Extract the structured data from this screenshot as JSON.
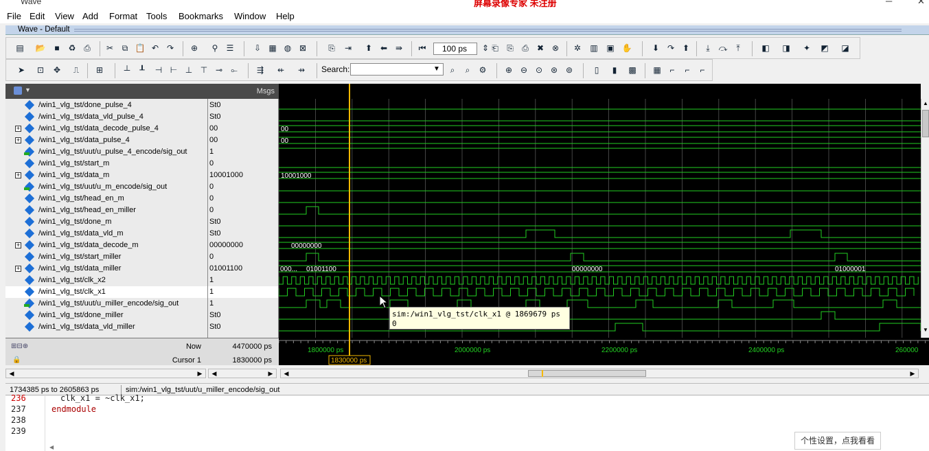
{
  "window": {
    "app_title": "Wave",
    "watermark": "屏幕录像专家 未注册",
    "controls": [
      "─",
      "□",
      "✕"
    ]
  },
  "menu": [
    "File",
    "Edit",
    "View",
    "Add",
    "Format",
    "Tools",
    "Bookmarks",
    "Window",
    "Help"
  ],
  "wave_window": {
    "title": "Wave - Default"
  },
  "toolbar": {
    "zoom_value": "100 ps",
    "search_label": "Search:",
    "search_value": ""
  },
  "panes": {
    "msgs_header": "Msgs",
    "now_label": "Now",
    "now_value": "4470000 ps",
    "cursor_label": "Cursor 1",
    "cursor_value": "1830000 ps",
    "cursor_time_tag": "1830000 ps"
  },
  "signals": [
    {
      "name": "/win1_vlg_tst/done_pulse_4",
      "value": "St0",
      "expandable": false,
      "kind": "net",
      "wave_text": ""
    },
    {
      "name": "/win1_vlg_tst/data_vld_pulse_4",
      "value": "St0",
      "expandable": false,
      "kind": "net",
      "wave_text": ""
    },
    {
      "name": "/win1_vlg_tst/data_decode_pulse_4",
      "value": "00",
      "expandable": true,
      "kind": "net",
      "wave_text": "00"
    },
    {
      "name": "/win1_vlg_tst/data_pulse_4",
      "value": "00",
      "expandable": true,
      "kind": "net",
      "wave_text": "00"
    },
    {
      "name": "/win1_vlg_tst/uut/u_pulse_4_encode/sig_out",
      "value": "1",
      "expandable": false,
      "kind": "out",
      "wave_text": ""
    },
    {
      "name": "/win1_vlg_tst/start_m",
      "value": "0",
      "expandable": false,
      "kind": "net",
      "wave_text": ""
    },
    {
      "name": "/win1_vlg_tst/data_m",
      "value": "10001000",
      "expandable": true,
      "kind": "net",
      "wave_text": "10001000"
    },
    {
      "name": "/win1_vlg_tst/uut/u_m_encode/sig_out",
      "value": "0",
      "expandable": false,
      "kind": "out",
      "wave_text": ""
    },
    {
      "name": "/win1_vlg_tst/head_en_m",
      "value": "0",
      "expandable": false,
      "kind": "net",
      "wave_text": ""
    },
    {
      "name": "/win1_vlg_tst/head_en_miller",
      "value": "0",
      "expandable": false,
      "kind": "net",
      "wave_text": ""
    },
    {
      "name": "/win1_vlg_tst/done_m",
      "value": "St0",
      "expandable": false,
      "kind": "net",
      "wave_text": ""
    },
    {
      "name": "/win1_vlg_tst/data_vld_m",
      "value": "St0",
      "expandable": false,
      "kind": "net",
      "wave_text": ""
    },
    {
      "name": "/win1_vlg_tst/data_decode_m",
      "value": "00000000",
      "expandable": true,
      "kind": "net",
      "wave_text": "00000000"
    },
    {
      "name": "/win1_vlg_tst/start_miller",
      "value": "0",
      "expandable": false,
      "kind": "net",
      "wave_text": ""
    },
    {
      "name": "/win1_vlg_tst/data_miller",
      "value": "01001100",
      "expandable": true,
      "kind": "net",
      "wave_text": "01001100"
    },
    {
      "name": "/win1_vlg_tst/clk_x2",
      "value": "1",
      "expandable": false,
      "kind": "net",
      "wave_text": ""
    },
    {
      "name": "/win1_vlg_tst/clk_x1",
      "value": "1",
      "expandable": false,
      "kind": "net",
      "wave_text": ""
    },
    {
      "name": "/win1_vlg_tst/uut/u_miller_encode/sig_out",
      "value": "1",
      "expandable": false,
      "kind": "out",
      "wave_text": ""
    },
    {
      "name": "/win1_vlg_tst/done_miller",
      "value": "St0",
      "expandable": false,
      "kind": "net",
      "wave_text": ""
    },
    {
      "name": "/win1_vlg_tst/data_vld_miller",
      "value": "St0",
      "expandable": false,
      "kind": "net",
      "wave_text": ""
    }
  ],
  "wave_labels": {
    "data_decode_m_first": "00000000",
    "data_miller_first": "000...",
    "data_miller_second": "01001100",
    "data_miller_third": "00000000",
    "data_miller_fourth": "01000001"
  },
  "time_axis": [
    "1800000 ps",
    "2000000 ps",
    "2200000 ps",
    "2400000 ps",
    "260000"
  ],
  "tooltip": {
    "line1": "sim:/win1_vlg_tst/clk_x1 @ 1869679 ps",
    "line2": "0"
  },
  "status": {
    "range": "1734385 ps to 2605863 ps",
    "path": "sim:/win1_vlg_tst/uut/u_miller_encode/sig_out"
  },
  "source": {
    "lines": [
      {
        "num": "236",
        "text": "clk_x1 = ~clk_x1;"
      },
      {
        "num": "237",
        "text": "endmodule"
      },
      {
        "num": "238",
        "text": ""
      },
      {
        "num": "239",
        "text": ""
      }
    ]
  },
  "popup": {
    "label": "个性设置，点我看看"
  },
  "colors": {
    "wave_green": "#22d022",
    "cursor": "#f5b800",
    "axis_text": "#22d022",
    "selected_diamond": "#1d6fd6"
  }
}
